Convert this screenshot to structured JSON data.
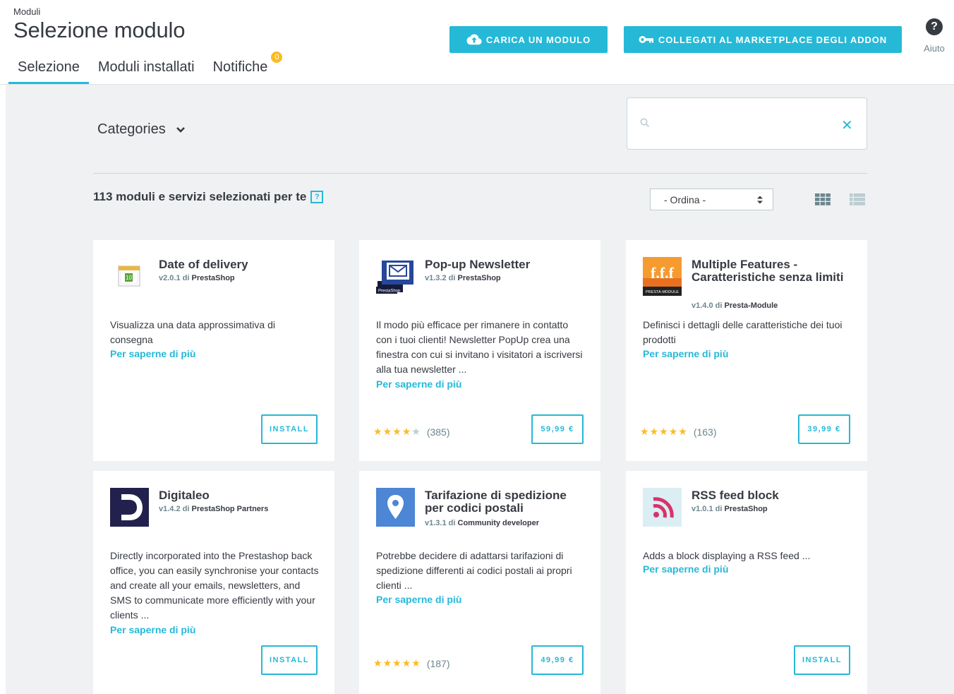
{
  "header": {
    "breadcrumb": "Moduli",
    "title": "Selezione modulo",
    "upload_button": "CARICA UN MODULO",
    "marketplace_button": "COLLEGATI AL MARKETPLACE DEGLI ADDON",
    "help_label": "Aiuto",
    "help_icon": "?"
  },
  "tabs": [
    {
      "label": "Selezione",
      "active": true
    },
    {
      "label": "Moduli installati"
    },
    {
      "label": "Notifiche",
      "badge": "0"
    }
  ],
  "filters": {
    "categories_label": "Categories",
    "search_value": "",
    "search_clear": "✕",
    "sort_label": "- Ordina -"
  },
  "results": {
    "count_title": "113 moduli e servizi selezionati per te",
    "info_icon": "?"
  },
  "colors": {
    "accent": "#25b9d7",
    "star": "#fbbb22",
    "badge": "#fbbb22"
  },
  "cards": [
    {
      "name": "Date of delivery",
      "version": "v2.0.1",
      "by": "di",
      "author": "PrestaShop",
      "description": "Visualizza una data approssimativa di consegna",
      "more": "Per saperne di più",
      "button": "INSTALL",
      "icon": "calendar-icon"
    },
    {
      "name": "Pop-up Newsletter",
      "version": "v1.3.2",
      "by": "di",
      "author": "PrestaShop",
      "description": "Il modo più efficace per rimanere in contatto con i tuoi clienti! Newsletter PopUp crea una finestra con cui si invitano i visitatori a iscriversi alla tua newsletter ...",
      "more": "Per saperne di più",
      "button": "59,99 €",
      "rating_count": "(385)",
      "rating": 4,
      "icon": "newsletter-icon",
      "logo_text": "PrestaShop"
    },
    {
      "name": "Multiple Features - Caratteristiche senza limiti",
      "version": "v1.4.0",
      "by": "di",
      "author": "Presta-Module",
      "description": "Definisci i dettagli delle caratteristiche dei tuoi prodotti",
      "more": "Per saperne di più",
      "button": "39,99 €",
      "rating_count": "(163)",
      "rating": 4.5,
      "icon": "features-icon",
      "logo_text": "PRESTA-MODULE"
    },
    {
      "name": "Digitaleo",
      "version": "v1.4.2",
      "by": "di",
      "author": "PrestaShop Partners",
      "description": "Directly incorporated into the Prestashop back office, you can easily synchronise your contacts and create all your emails, newsletters, and SMS to communicate more efficiently with your clients ...",
      "more": "Per saperne di più",
      "button": "INSTALL",
      "icon": "digitaleo-icon"
    },
    {
      "name": "Tarifazione di spedizione per codici postali",
      "version": "v1.3.1",
      "by": "di",
      "author": "Community developer",
      "description": "Potrebbe decidere di adattarsi tarifazioni di spedizione differenti ai codici postali ai propri clienti ...",
      "more": "Per saperne di più",
      "button": "49,99 €",
      "rating_count": "(187)",
      "rating": 4.5,
      "icon": "map-pin-icon"
    },
    {
      "name": "RSS feed block",
      "version": "v1.0.1",
      "by": "di",
      "author": "PrestaShop",
      "description": "Adds a block displaying a RSS feed ...",
      "more": "Per saperne di più",
      "button": "INSTALL",
      "icon": "rss-icon"
    }
  ]
}
